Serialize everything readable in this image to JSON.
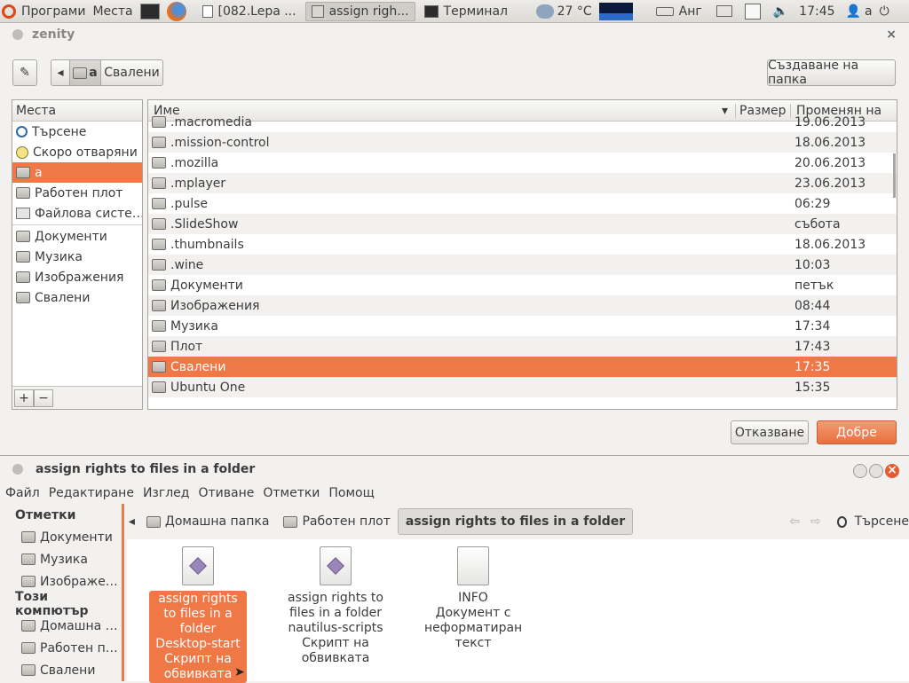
{
  "panel": {
    "apps_label": "Програми",
    "places_label": "Места",
    "tasks": [
      "[082.Lepa ...",
      "assign righ...",
      "Терминал"
    ],
    "weather": "27 °C",
    "keyboard": "Анг",
    "clock": "17:45",
    "user": "a"
  },
  "zenity": {
    "title": "zenity",
    "path_buttons": [
      "a",
      "Свалени"
    ],
    "create_folder": "Създаване на папка",
    "places_header": "Места",
    "places": [
      "Търсене",
      "Скоро отваряни",
      "a",
      "Работен плот",
      "Файлова систе…",
      "Документи",
      "Музика",
      "Изображения",
      "Свалени"
    ],
    "col_name": "Име",
    "col_size": "Размер",
    "col_modified": "Променян на",
    "files": [
      {
        "name": ".macromedia",
        "date": "19.06.2013"
      },
      {
        "name": ".mission-control",
        "date": "18.06.2013"
      },
      {
        "name": ".mozilla",
        "date": "20.06.2013"
      },
      {
        "name": ".mplayer",
        "date": "23.06.2013"
      },
      {
        "name": ".pulse",
        "date": "06:29"
      },
      {
        "name": ".SlideShow",
        "date": "събота"
      },
      {
        "name": ".thumbnails",
        "date": "18.06.2013"
      },
      {
        "name": ".wine",
        "date": "10:03"
      },
      {
        "name": "Документи",
        "date": "петък"
      },
      {
        "name": "Изображения",
        "date": "08:44"
      },
      {
        "name": "Музика",
        "date": "17:34"
      },
      {
        "name": "Плот",
        "date": "17:43"
      },
      {
        "name": "Свалени",
        "date": "17:35"
      },
      {
        "name": "Ubuntu One",
        "date": "15:35"
      }
    ],
    "add_symbol": "+",
    "remove_symbol": "−",
    "cancel": "Отказване",
    "ok": "Добре"
  },
  "nautilus": {
    "title": "assign rights to files in a folder",
    "menu": [
      "Файл",
      "Редактиране",
      "Изглед",
      "Отиване",
      "Отметки",
      "Помощ"
    ],
    "sidebar_bookmarks": "Отметки",
    "bookmarks": [
      "Документи",
      "Музика",
      "Изображе…"
    ],
    "sidebar_computer": "Този компютър",
    "computer": [
      "Домашна …",
      "Работен п…",
      "Свалени"
    ],
    "crumbs": [
      "Домашна папка",
      "Работен плот",
      "assign rights to files in a folder"
    ],
    "search": "Търсене",
    "files": [
      {
        "name": "assign rights to files in a folder Desktop-start",
        "type": "Скрипт на обвивката"
      },
      {
        "name": "assign rights to files in a folder nautilus-scripts",
        "type": "Скрипт на обвивката"
      },
      {
        "name": "INFO",
        "type": "Документ с неформатиран текст"
      }
    ]
  },
  "colors": {
    "accent": "#f07746",
    "panel": "#dcdad5"
  }
}
